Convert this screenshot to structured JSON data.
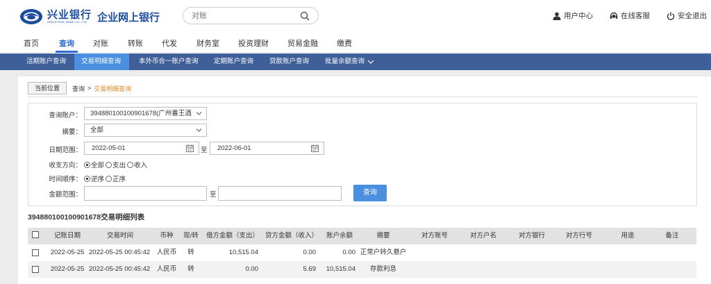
{
  "header": {
    "logo_cn": "兴业银行",
    "logo_en": "INDUSTRIAL BANK CO.,LTD.",
    "portal": "企业网上银行",
    "search_placeholder": "对账",
    "links": [
      {
        "label": "用户中心",
        "icon": "user-icon"
      },
      {
        "label": "在线客服",
        "icon": "headset-icon"
      },
      {
        "label": "安全退出",
        "icon": "power-icon"
      }
    ]
  },
  "main_nav": [
    "首页",
    "查询",
    "对账",
    "转账",
    "代发",
    "财务室",
    "投资理财",
    "贸易金融",
    "缴费"
  ],
  "main_nav_active": "查询",
  "sub_nav": [
    "活期账户查询",
    "交易明细查询",
    "本外币合一账户查询",
    "定期账户查询",
    "贷款账户查询",
    "批量余额查询"
  ],
  "sub_nav_active": "交易明细查询",
  "breadcrumb": {
    "current_label": "当前位置",
    "level1": "查询",
    "sep": ">",
    "level2": "交易明细查询"
  },
  "form": {
    "account_label": "查询账户：",
    "account_value": "394880100100901678(广州番王酒",
    "summary_label": "摘要：",
    "summary_value": "全部",
    "date_label": "日期范围：",
    "date_from": "2022-05-01",
    "date_to_sep": "至",
    "date_to": "2022-06-01",
    "direction_label": "收支方向：",
    "direction_options": [
      {
        "label": "全部",
        "checked": true
      },
      {
        "label": "支出",
        "checked": false
      },
      {
        "label": "收入",
        "checked": false
      }
    ],
    "order_label": "时间顺序：",
    "order_options": [
      {
        "label": "逆序",
        "checked": true
      },
      {
        "label": "正序",
        "checked": false
      }
    ],
    "amount_label": "金额范围：",
    "amount_sep": "至",
    "amount_from": "",
    "amount_to": "",
    "query_button": "查询"
  },
  "table": {
    "title": "394880100100901678交易明细列表",
    "columns": [
      "记账日期",
      "交易时间",
      "币种",
      "现/转",
      "借方金额（支出）",
      "贷方金额（收入）",
      "账户余额",
      "摘要",
      "对方账号",
      "对方户名",
      "对方银行",
      "对方行号",
      "用途",
      "备注"
    ],
    "rows": [
      {
        "date": "2022-05-25",
        "time": "2022-05-25 00:45:42",
        "currency": "人民币",
        "type": "转",
        "debit": "10,515.04",
        "credit": "0.00",
        "balance": "0.00",
        "summary": "正常户转久悬户"
      },
      {
        "date": "2022-05-25",
        "time": "2022-05-25 00:45:42",
        "currency": "人民币",
        "type": "转",
        "debit": "0.00",
        "credit": "5.69",
        "balance": "10,515.04",
        "summary": "存款利息"
      }
    ]
  },
  "colors": {
    "brand": "#1b4c9e",
    "accent": "#2f6cd0",
    "subnav_bg": "#3e5f98",
    "subnav_active": "#4a8fe0",
    "crumb_highlight": "#e88724"
  }
}
